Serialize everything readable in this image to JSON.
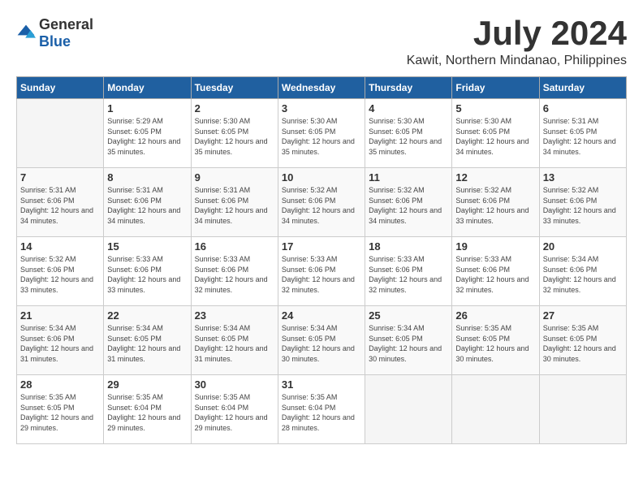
{
  "header": {
    "logo_general": "General",
    "logo_blue": "Blue",
    "month_title": "July 2024",
    "location": "Kawit, Northern Mindanao, Philippines"
  },
  "weekdays": [
    "Sunday",
    "Monday",
    "Tuesday",
    "Wednesday",
    "Thursday",
    "Friday",
    "Saturday"
  ],
  "weeks": [
    [
      {
        "day": "",
        "sunrise": "",
        "sunset": "",
        "daylight": ""
      },
      {
        "day": "1",
        "sunrise": "Sunrise: 5:29 AM",
        "sunset": "Sunset: 6:05 PM",
        "daylight": "Daylight: 12 hours and 35 minutes."
      },
      {
        "day": "2",
        "sunrise": "Sunrise: 5:30 AM",
        "sunset": "Sunset: 6:05 PM",
        "daylight": "Daylight: 12 hours and 35 minutes."
      },
      {
        "day": "3",
        "sunrise": "Sunrise: 5:30 AM",
        "sunset": "Sunset: 6:05 PM",
        "daylight": "Daylight: 12 hours and 35 minutes."
      },
      {
        "day": "4",
        "sunrise": "Sunrise: 5:30 AM",
        "sunset": "Sunset: 6:05 PM",
        "daylight": "Daylight: 12 hours and 35 minutes."
      },
      {
        "day": "5",
        "sunrise": "Sunrise: 5:30 AM",
        "sunset": "Sunset: 6:05 PM",
        "daylight": "Daylight: 12 hours and 34 minutes."
      },
      {
        "day": "6",
        "sunrise": "Sunrise: 5:31 AM",
        "sunset": "Sunset: 6:05 PM",
        "daylight": "Daylight: 12 hours and 34 minutes."
      }
    ],
    [
      {
        "day": "7",
        "sunrise": "Sunrise: 5:31 AM",
        "sunset": "Sunset: 6:06 PM",
        "daylight": "Daylight: 12 hours and 34 minutes."
      },
      {
        "day": "8",
        "sunrise": "Sunrise: 5:31 AM",
        "sunset": "Sunset: 6:06 PM",
        "daylight": "Daylight: 12 hours and 34 minutes."
      },
      {
        "day": "9",
        "sunrise": "Sunrise: 5:31 AM",
        "sunset": "Sunset: 6:06 PM",
        "daylight": "Daylight: 12 hours and 34 minutes."
      },
      {
        "day": "10",
        "sunrise": "Sunrise: 5:32 AM",
        "sunset": "Sunset: 6:06 PM",
        "daylight": "Daylight: 12 hours and 34 minutes."
      },
      {
        "day": "11",
        "sunrise": "Sunrise: 5:32 AM",
        "sunset": "Sunset: 6:06 PM",
        "daylight": "Daylight: 12 hours and 34 minutes."
      },
      {
        "day": "12",
        "sunrise": "Sunrise: 5:32 AM",
        "sunset": "Sunset: 6:06 PM",
        "daylight": "Daylight: 12 hours and 33 minutes."
      },
      {
        "day": "13",
        "sunrise": "Sunrise: 5:32 AM",
        "sunset": "Sunset: 6:06 PM",
        "daylight": "Daylight: 12 hours and 33 minutes."
      }
    ],
    [
      {
        "day": "14",
        "sunrise": "Sunrise: 5:32 AM",
        "sunset": "Sunset: 6:06 PM",
        "daylight": "Daylight: 12 hours and 33 minutes."
      },
      {
        "day": "15",
        "sunrise": "Sunrise: 5:33 AM",
        "sunset": "Sunset: 6:06 PM",
        "daylight": "Daylight: 12 hours and 33 minutes."
      },
      {
        "day": "16",
        "sunrise": "Sunrise: 5:33 AM",
        "sunset": "Sunset: 6:06 PM",
        "daylight": "Daylight: 12 hours and 32 minutes."
      },
      {
        "day": "17",
        "sunrise": "Sunrise: 5:33 AM",
        "sunset": "Sunset: 6:06 PM",
        "daylight": "Daylight: 12 hours and 32 minutes."
      },
      {
        "day": "18",
        "sunrise": "Sunrise: 5:33 AM",
        "sunset": "Sunset: 6:06 PM",
        "daylight": "Daylight: 12 hours and 32 minutes."
      },
      {
        "day": "19",
        "sunrise": "Sunrise: 5:33 AM",
        "sunset": "Sunset: 6:06 PM",
        "daylight": "Daylight: 12 hours and 32 minutes."
      },
      {
        "day": "20",
        "sunrise": "Sunrise: 5:34 AM",
        "sunset": "Sunset: 6:06 PM",
        "daylight": "Daylight: 12 hours and 32 minutes."
      }
    ],
    [
      {
        "day": "21",
        "sunrise": "Sunrise: 5:34 AM",
        "sunset": "Sunset: 6:06 PM",
        "daylight": "Daylight: 12 hours and 31 minutes."
      },
      {
        "day": "22",
        "sunrise": "Sunrise: 5:34 AM",
        "sunset": "Sunset: 6:05 PM",
        "daylight": "Daylight: 12 hours and 31 minutes."
      },
      {
        "day": "23",
        "sunrise": "Sunrise: 5:34 AM",
        "sunset": "Sunset: 6:05 PM",
        "daylight": "Daylight: 12 hours and 31 minutes."
      },
      {
        "day": "24",
        "sunrise": "Sunrise: 5:34 AM",
        "sunset": "Sunset: 6:05 PM",
        "daylight": "Daylight: 12 hours and 30 minutes."
      },
      {
        "day": "25",
        "sunrise": "Sunrise: 5:34 AM",
        "sunset": "Sunset: 6:05 PM",
        "daylight": "Daylight: 12 hours and 30 minutes."
      },
      {
        "day": "26",
        "sunrise": "Sunrise: 5:35 AM",
        "sunset": "Sunset: 6:05 PM",
        "daylight": "Daylight: 12 hours and 30 minutes."
      },
      {
        "day": "27",
        "sunrise": "Sunrise: 5:35 AM",
        "sunset": "Sunset: 6:05 PM",
        "daylight": "Daylight: 12 hours and 30 minutes."
      }
    ],
    [
      {
        "day": "28",
        "sunrise": "Sunrise: 5:35 AM",
        "sunset": "Sunset: 6:05 PM",
        "daylight": "Daylight: 12 hours and 29 minutes."
      },
      {
        "day": "29",
        "sunrise": "Sunrise: 5:35 AM",
        "sunset": "Sunset: 6:04 PM",
        "daylight": "Daylight: 12 hours and 29 minutes."
      },
      {
        "day": "30",
        "sunrise": "Sunrise: 5:35 AM",
        "sunset": "Sunset: 6:04 PM",
        "daylight": "Daylight: 12 hours and 29 minutes."
      },
      {
        "day": "31",
        "sunrise": "Sunrise: 5:35 AM",
        "sunset": "Sunset: 6:04 PM",
        "daylight": "Daylight: 12 hours and 28 minutes."
      },
      {
        "day": "",
        "sunrise": "",
        "sunset": "",
        "daylight": ""
      },
      {
        "day": "",
        "sunrise": "",
        "sunset": "",
        "daylight": ""
      },
      {
        "day": "",
        "sunrise": "",
        "sunset": "",
        "daylight": ""
      }
    ]
  ]
}
